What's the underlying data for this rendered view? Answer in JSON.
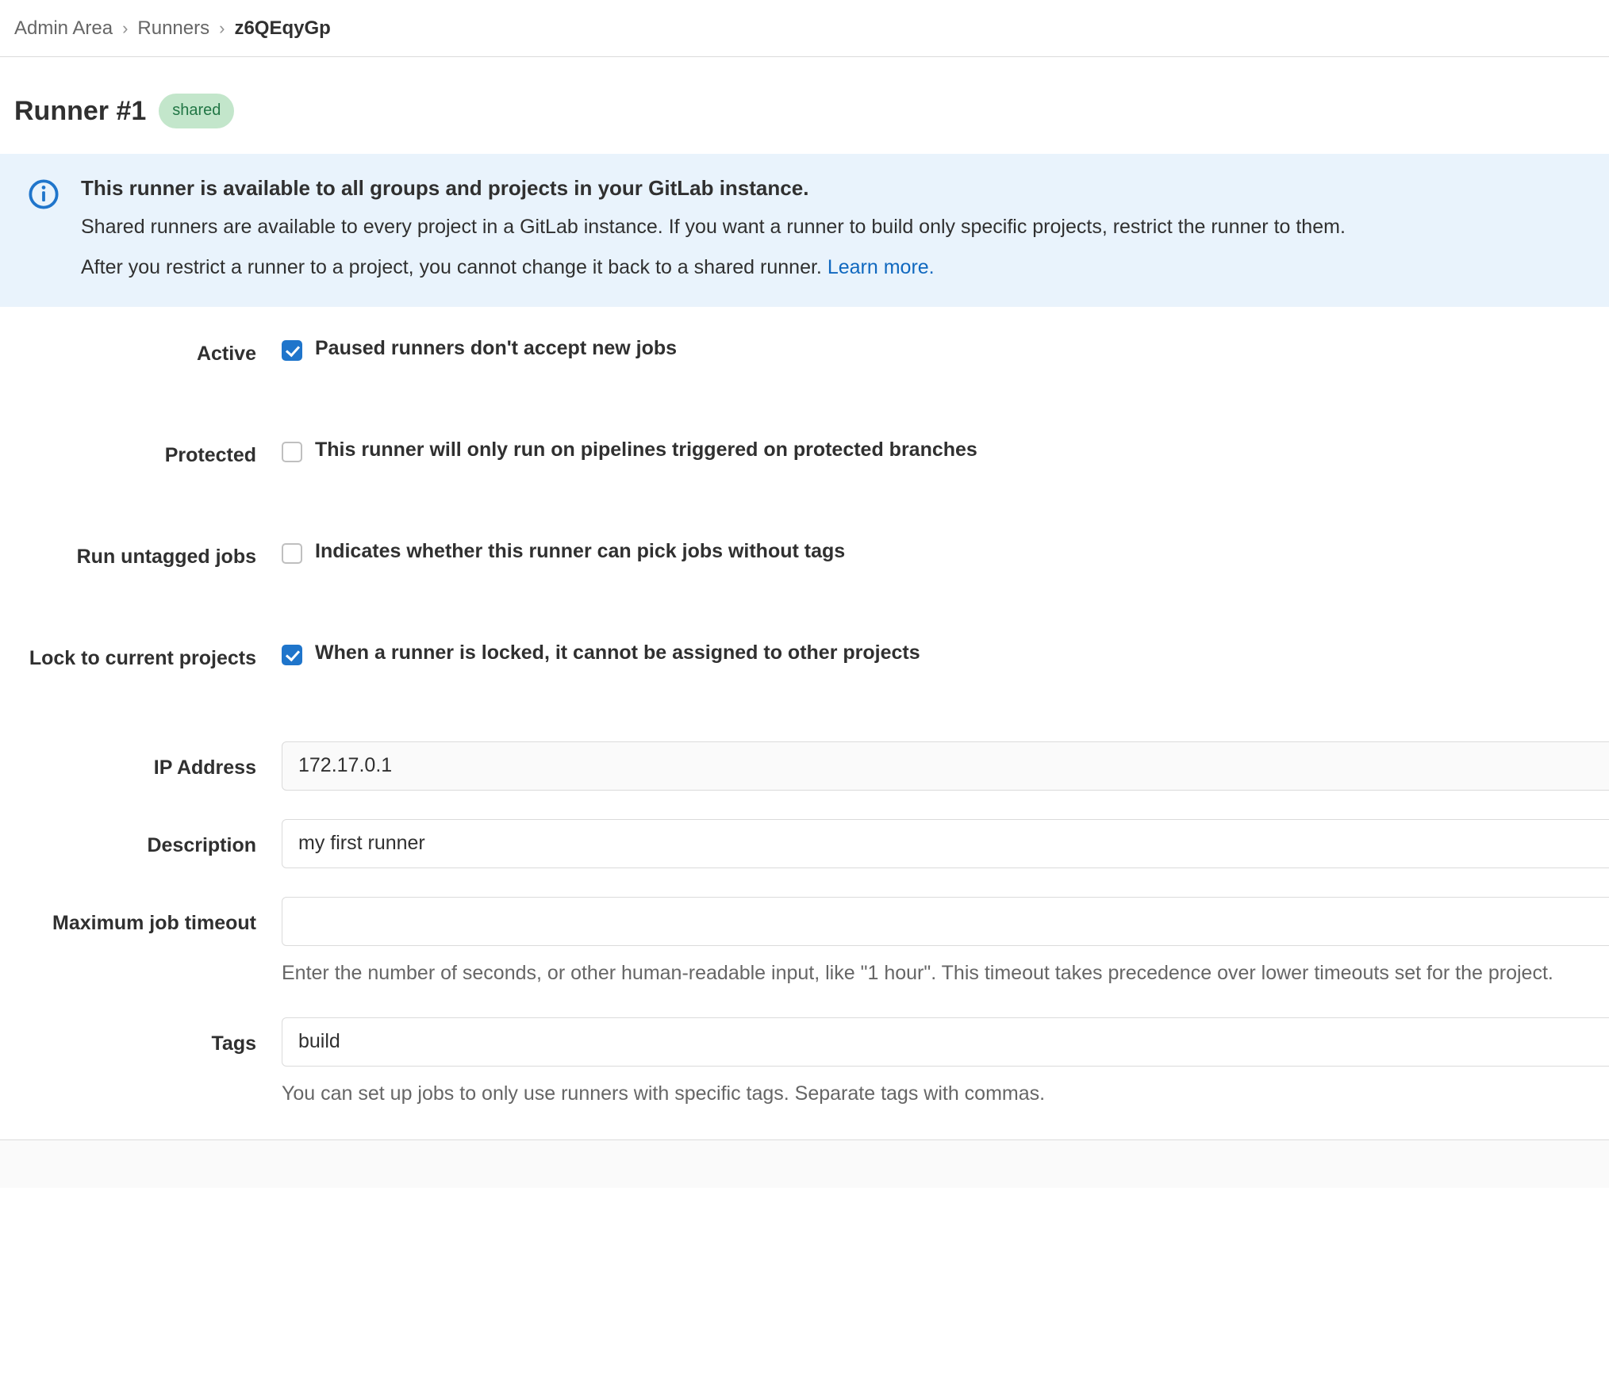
{
  "breadcrumb": {
    "items": [
      {
        "label": "Admin Area",
        "current": false
      },
      {
        "label": "Runners",
        "current": false
      },
      {
        "label": "z6QEqyGp",
        "current": true
      }
    ],
    "separator": "›"
  },
  "header": {
    "title": "Runner #1",
    "badge": "shared",
    "badge_bg": "#c3e6cb",
    "badge_fg": "#217645"
  },
  "alert": {
    "icon": "info-circle-icon",
    "accent": "#1f75cb",
    "background": "#e9f3fc",
    "title": "This runner is available to all groups and projects in your GitLab instance.",
    "paragraph_1": "Shared runners are available to every project in a GitLab instance. If you want a runner to build only specific projects, restrict the runner to them.",
    "paragraph_2": "After you restrict a runner to a project, you cannot change it back to a shared runner.",
    "link_label": "Learn more.",
    "link_color": "#1068bf"
  },
  "form": {
    "checkboxes": [
      {
        "label": "Active",
        "description": "Paused runners don't accept new jobs",
        "checked": true
      },
      {
        "label": "Protected",
        "description": "This runner will only run on pipelines triggered on protected branches",
        "checked": false
      },
      {
        "label": "Run untagged jobs",
        "description": "Indicates whether this runner can pick jobs without tags",
        "checked": false
      },
      {
        "label": "Lock to current projects",
        "description": "When a runner is locked, it cannot be assigned to other projects",
        "checked": true
      }
    ],
    "ip_address": {
      "label": "IP Address",
      "value": "172.17.0.1",
      "placeholder": "",
      "readonly": true
    },
    "description": {
      "label": "Description",
      "value": "my first runner",
      "placeholder": ""
    },
    "max_timeout": {
      "label": "Maximum job timeout",
      "value": "",
      "placeholder": "",
      "help": "Enter the number of seconds, or other human-readable input, like \"1 hour\". This timeout takes precedence over lower timeouts set for the project."
    },
    "tags": {
      "label": "Tags",
      "value": "build",
      "placeholder": "",
      "help": "You can set up jobs to only use runners with specific tags. Separate tags with commas."
    }
  }
}
